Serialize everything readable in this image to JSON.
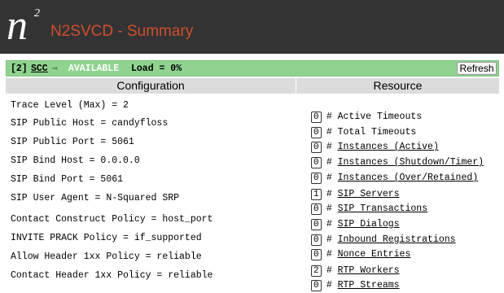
{
  "header": {
    "logo_letter": "n",
    "logo_superscript": "2",
    "title": "N2SVCD - Summary"
  },
  "status": {
    "index": "[2]",
    "name_link": "SCC",
    "arrow": "⇒",
    "state": "AVAILABLE",
    "load": "Load = 0%",
    "refresh_label": "Refresh"
  },
  "columns": {
    "configuration": "Configuration",
    "resource": "Resource"
  },
  "configuration": [
    "Trace Level (Max) = 2",
    "SIP Public Host = candyfloss",
    "SIP Public Port = 5061",
    "SIP Bind Host = 0.0.0.0",
    "SIP Bind Port = 5061",
    "SIP User Agent = N-Squared SRP",
    "Contact Construct Policy = host_port",
    "INVITE PRACK Policy = if_supported",
    "Allow Header 1xx Policy = reliable",
    "Contact Header 1xx Policy = reliable"
  ],
  "resources": [
    {
      "count": "0",
      "label": "Active Timeouts"
    },
    {
      "count": "0",
      "label": "Total Timeouts"
    },
    {
      "count": "0",
      "label": "Instances (Active)"
    },
    {
      "count": "0",
      "label": "Instances (Shutdown/Timer)"
    },
    {
      "count": "0",
      "label": "Instances (Over/Retained)"
    },
    {
      "count": "1",
      "label": "SIP Servers"
    },
    {
      "count": "0",
      "label": "SIP Transactions"
    },
    {
      "count": "0",
      "label": "SIP Dialogs"
    },
    {
      "count": "0",
      "label": "Inbound Registrations"
    },
    {
      "count": "0",
      "label": "Nonce Entries"
    },
    {
      "count": "2",
      "label": "RTP Workers"
    },
    {
      "count": "0",
      "label": "RTP Streams"
    }
  ],
  "colors": {
    "header_bg": "#333333",
    "title_accent": "#d24e2f",
    "status_bg": "#8fd38f",
    "column_header_bg": "#dcdcdc"
  }
}
